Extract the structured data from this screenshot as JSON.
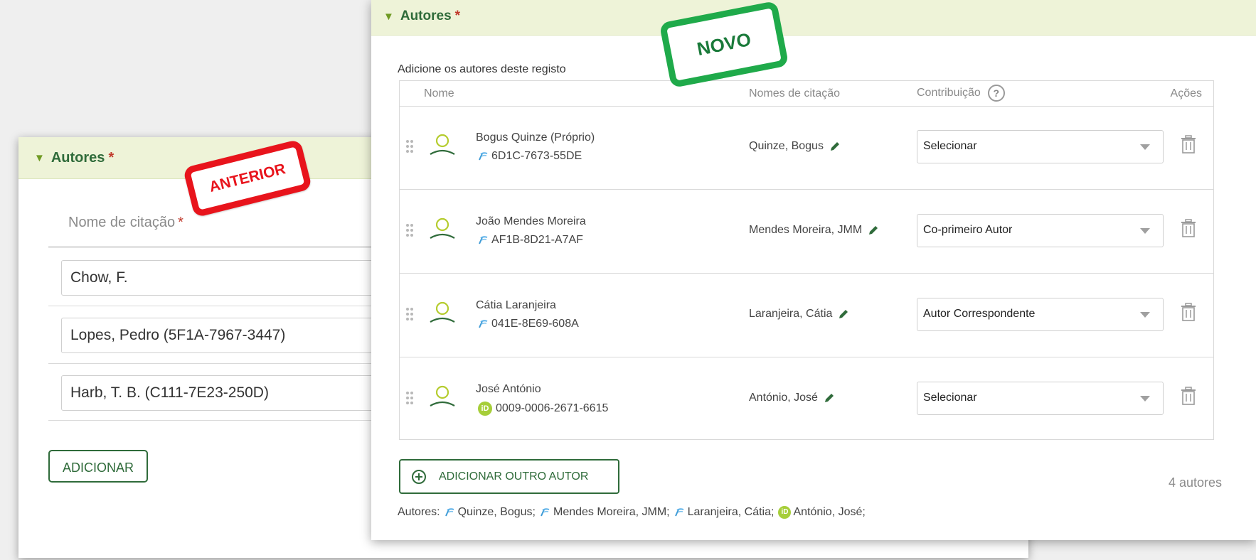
{
  "old_panel": {
    "section_title": "Autores",
    "required_mark": "*",
    "field_label": "Nome de citação",
    "entries": [
      "Chow, F.",
      "Lopes, Pedro (5F1A-7967-3447)",
      "Harb, T. B.  (C111-7E23-250D)"
    ],
    "add_button": "ADICIONAR",
    "stamp": "ANTERIOR"
  },
  "new_panel": {
    "section_title": "Autores",
    "required_mark": "*",
    "stamp": "NOVO",
    "intro": "Adicione os autores deste registo",
    "columns": {
      "name": "Nome",
      "citation": "Nomes de citação",
      "contribution": "Contribuição",
      "actions": "Ações"
    },
    "help_icon": "?",
    "authors": [
      {
        "name": "Bogus Quinze (Próprio)",
        "id": "6D1C-7673-55DE",
        "id_type": "ciencia-id-icon",
        "citation": "Quinze, Bogus",
        "contribution": "Selecionar"
      },
      {
        "name": "João Mendes Moreira",
        "id": "AF1B-8D21-A7AF",
        "id_type": "ciencia-id-icon",
        "citation": "Mendes Moreira, JMM",
        "contribution": "Co-primeiro Autor"
      },
      {
        "name": "Cátia Laranjeira",
        "id": "041E-8E69-608A",
        "id_type": "ciencia-id-icon",
        "citation": "Laranjeira, Cátia",
        "contribution": "Autor Correspondente"
      },
      {
        "name": "José António",
        "id": "0009-0006-2671-6615",
        "id_type": "orcid-icon",
        "citation": "António, José",
        "contribution": "Selecionar"
      }
    ],
    "add_author_button": "ADICIONAR OUTRO AUTOR",
    "author_count": "4 autores",
    "summary_label": "Autores:",
    "orcid_badge": "iD",
    "summary_items": [
      {
        "text": "Quinze, Bogus;",
        "icon": "ciencia-id-icon"
      },
      {
        "text": "Mendes Moreira, JMM;",
        "icon": "ciencia-id-icon"
      },
      {
        "text": "Laranjeira, Cátia;",
        "icon": "ciencia-id-icon"
      },
      {
        "text": "António, José;",
        "icon": "orcid-icon"
      }
    ]
  },
  "colors": {
    "brand_green": "#2f6b3a",
    "header_bg": "#eef3d8",
    "stamp_red": "#e8141c",
    "stamp_green": "#1faa4a",
    "orcid": "#a6ce39"
  }
}
